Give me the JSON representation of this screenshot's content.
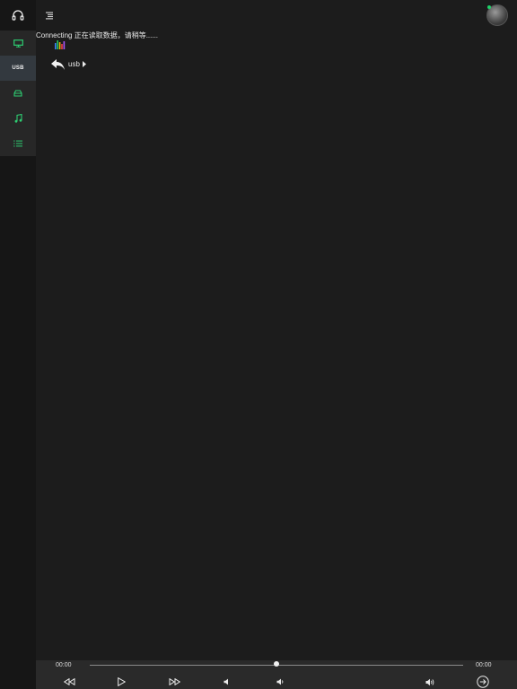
{
  "sidebar": {
    "items": [
      {
        "icon": "monitor-icon",
        "active": false
      },
      {
        "icon": "usb-icon",
        "label": "USB",
        "active": true
      },
      {
        "icon": "drive-icon",
        "active": false
      },
      {
        "icon": "music-note-icon",
        "active": false
      },
      {
        "icon": "list-icon",
        "active": false
      }
    ],
    "accent": "#2ecc71"
  },
  "header": {
    "status_text": "Connecting 正在读取数据，请稍等......",
    "breadcrumb": "usb"
  },
  "player": {
    "elapsed": "00:00",
    "duration": "00:00",
    "progress": 0.5
  }
}
